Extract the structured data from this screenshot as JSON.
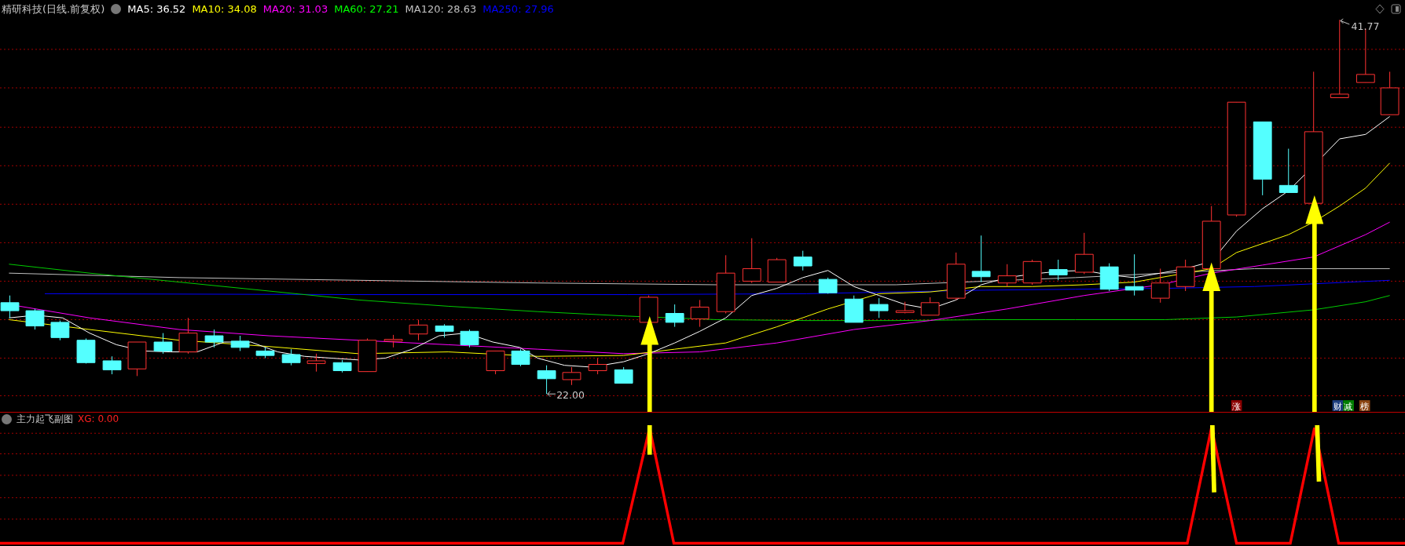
{
  "header": {
    "title": "精研科技(日线.前复权)",
    "ma_lines": [
      {
        "text": "MA5: 36.52",
        "color": "#ffffff"
      },
      {
        "text": "MA10: 34.08",
        "color": "#ffff00"
      },
      {
        "text": "MA20: 31.03",
        "color": "#ff00ff"
      },
      {
        "text": "MA60: 27.21",
        "color": "#00ff00"
      },
      {
        "text": "MA120: 28.63",
        "color": "#c0c0c0"
      },
      {
        "text": "MA250: 27.96",
        "color": "#0000ff"
      }
    ]
  },
  "main_chart": {
    "high_label": "41.77",
    "low_label": "22.00",
    "badges": [
      {
        "text": "涨",
        "color": "#8b0000"
      },
      {
        "text": "财",
        "color": "#1f3f7f"
      },
      {
        "text": "减",
        "color": "#007f00"
      },
      {
        "text": "榜",
        "color": "#8b4513"
      }
    ]
  },
  "sub_chart": {
    "title": "主力起飞副图",
    "indicator": "XG: 0.00"
  }
}
